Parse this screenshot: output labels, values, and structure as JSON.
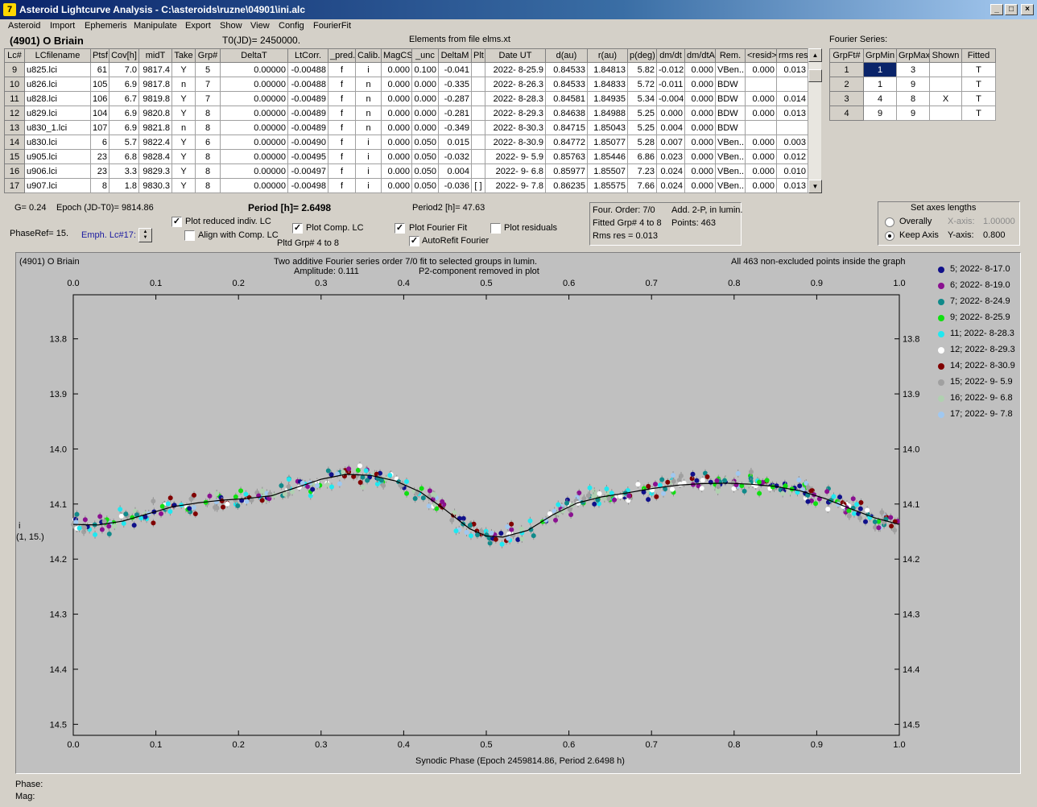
{
  "window": {
    "title": "Asteroid Lightcurve Analysis - C:\\asteroids\\ruzne\\04901\\ini.alc",
    "icon_letter": "7",
    "min_glyph": "_",
    "max_glyph": "□",
    "close_glyph": "×"
  },
  "menu": [
    "Asteroid",
    "Import",
    "Ephemeris",
    "Manipulate",
    "Export",
    "Show",
    "View",
    "Config",
    "FourierFit"
  ],
  "header": {
    "asteroid": "(4901) O Briain",
    "t0": "T0(JD)= 2450000.",
    "elements": "Elements from file elms.xt",
    "fourier_series_label": "Fourier Series:"
  },
  "lc_table": {
    "columns": [
      "Lc#",
      "LCfilename",
      "Ptsf",
      "Cov[h]",
      "midT",
      "Take",
      "Grp#",
      "DeltaT",
      "LtCorr.",
      "_pred.",
      "Calib.",
      "MagCS",
      "_unc",
      "DeltaM",
      "Plt",
      "Date UT",
      "d(au)",
      "r(au)",
      "p(deg)",
      "dm/dt",
      "dm/dtA",
      "Rem.",
      "<resid>",
      "rms res"
    ],
    "rows": [
      [
        "9",
        "u825.lci",
        "61",
        "7.0",
        "9817.4",
        "Y",
        "5",
        "0.00000",
        "-0.00488",
        "f",
        "i",
        "0.000",
        "0.100",
        "-0.041",
        "",
        "2022- 8-25.9",
        "0.84533",
        "1.84813",
        "5.82",
        "-0.012",
        "0.000",
        "VBen..",
        "0.000",
        "0.013"
      ],
      [
        "10",
        "u826.lci",
        "105",
        "6.9",
        "9817.8",
        "n",
        "7",
        "0.00000",
        "-0.00488",
        "f",
        "n",
        "0.000",
        "0.000",
        "-0.335",
        "",
        "2022- 8-26.3",
        "0.84533",
        "1.84833",
        "5.72",
        "-0.011",
        "0.000",
        "BDW",
        "",
        ""
      ],
      [
        "11",
        "u828.lci",
        "106",
        "6.7",
        "9819.8",
        "Y",
        "7",
        "0.00000",
        "-0.00489",
        "f",
        "n",
        "0.000",
        "0.000",
        "-0.287",
        "",
        "2022- 8-28.3",
        "0.84581",
        "1.84935",
        "5.34",
        "-0.004",
        "0.000",
        "BDW",
        "0.000",
        "0.014"
      ],
      [
        "12",
        "u829.lci",
        "104",
        "6.9",
        "9820.8",
        "Y",
        "8",
        "0.00000",
        "-0.00489",
        "f",
        "n",
        "0.000",
        "0.000",
        "-0.281",
        "",
        "2022- 8-29.3",
        "0.84638",
        "1.84988",
        "5.25",
        "0.000",
        "0.000",
        "BDW",
        "0.000",
        "0.013"
      ],
      [
        "13",
        "u830_1.lci",
        "107",
        "6.9",
        "9821.8",
        "n",
        "8",
        "0.00000",
        "-0.00489",
        "f",
        "n",
        "0.000",
        "0.000",
        "-0.349",
        "",
        "2022- 8-30.3",
        "0.84715",
        "1.85043",
        "5.25",
        "0.004",
        "0.000",
        "BDW",
        "",
        ""
      ],
      [
        "14",
        "u830.lci",
        "6",
        "5.7",
        "9822.4",
        "Y",
        "6",
        "0.00000",
        "-0.00490",
        "f",
        "i",
        "0.000",
        "0.050",
        "0.015",
        "",
        "2022- 8-30.9",
        "0.84772",
        "1.85077",
        "5.28",
        "0.007",
        "0.000",
        "VBen..",
        "0.000",
        "0.003"
      ],
      [
        "15",
        "u905.lci",
        "23",
        "6.8",
        "9828.4",
        "Y",
        "8",
        "0.00000",
        "-0.00495",
        "f",
        "i",
        "0.000",
        "0.050",
        "-0.032",
        "",
        "2022- 9- 5.9",
        "0.85763",
        "1.85446",
        "6.86",
        "0.023",
        "0.000",
        "VBen..",
        "0.000",
        "0.012"
      ],
      [
        "16",
        "u906.lci",
        "23",
        "3.3",
        "9829.3",
        "Y",
        "8",
        "0.00000",
        "-0.00497",
        "f",
        "i",
        "0.000",
        "0.050",
        "0.004",
        "",
        "2022- 9- 6.8",
        "0.85977",
        "1.85507",
        "7.23",
        "0.024",
        "0.000",
        "VBen..",
        "0.000",
        "0.010"
      ],
      [
        "17",
        "u907.lci",
        "8",
        "1.8",
        "9830.3",
        "Y",
        "8",
        "0.00000",
        "-0.00498",
        "f",
        "i",
        "0.000",
        "0.050",
        "-0.036",
        "[ ]",
        "2022- 9- 7.8",
        "0.86235",
        "1.85575",
        "7.66",
        "0.024",
        "0.000",
        "VBen..",
        "0.000",
        "0.013"
      ]
    ],
    "scroll_up": "▲",
    "scroll_down": "▼"
  },
  "fourier_table": {
    "columns": [
      "GrpFt#",
      "GrpMin",
      "GrpMax",
      "Shown",
      "Fitted"
    ],
    "rows": [
      [
        "1",
        "1",
        "3",
        "",
        "T"
      ],
      [
        "2",
        "1",
        "9",
        "",
        "T"
      ],
      [
        "3",
        "4",
        "8",
        "X",
        "T"
      ],
      [
        "4",
        "9",
        "9",
        "",
        "T"
      ]
    ]
  },
  "controls": {
    "g": "G= 0.24",
    "epoch": "Epoch (JD-T0)= 9814.86",
    "period_label": "Period [h]= 2.6498",
    "period2_label": "Period2 [h]= 47.63",
    "phaseref": "PhaseRef= 15.",
    "emph": "Emph. Lc#17:",
    "plot_reduced": "Plot reduced indiv. LC",
    "align_comp": "Align with Comp. LC",
    "plot_comp": "Plot Comp. LC",
    "pltd_grp": "Pltd Grp#  4   to    8",
    "plot_fourier": "Plot Fourier Fit",
    "autorefit": "AutoRefit Fourier",
    "plot_residuals": "Plot residuals",
    "check": "✓",
    "four_order": "Four. Order:  7/0",
    "add_2p": "Add. 2-P, in lumin.",
    "fitted_grp": "Fitted Grp# 4 to 8",
    "points": "Points: 463",
    "rms_res": "Rms res      = 0.013",
    "axes_title": "Set axes lengths",
    "overally": "Overally",
    "keep_axis": "Keep Axis",
    "xaxis_label": "X-axis:",
    "xaxis_value": "1.00000",
    "yaxis_label": "Y-axis:",
    "yaxis_value": "0.800"
  },
  "chart_data": {
    "type": "scatter",
    "corner_label": "(4901) O Briain",
    "title": "Two additive Fourier series order 7/0 fit to selected groups in lumin.",
    "subtitle_left": "Amplitude: 0.111",
    "subtitle_right": "P2-component removed in plot",
    "note": "All 463 non-excluded points inside the graph",
    "xlabel": "Synodic Phase (Epoch 2459814.86, Period 2.6498 h)",
    "ylabel": "i",
    "ylabel2": "(1, 15.)",
    "xlim": [
      0.0,
      1.0
    ],
    "ylim": [
      13.72,
      14.52
    ],
    "y_inverted": true,
    "x_ticks": [
      "0.0",
      "0.1",
      "0.2",
      "0.3",
      "0.4",
      "0.5",
      "0.6",
      "0.7",
      "0.8",
      "0.9",
      "1.0"
    ],
    "y_ticks": [
      "13.8",
      "13.9",
      "14.0",
      "14.1",
      "14.2",
      "14.3",
      "14.4",
      "14.5"
    ],
    "fit_curve": [
      [
        0.0,
        14.137
      ],
      [
        0.03,
        14.138
      ],
      [
        0.06,
        14.131
      ],
      [
        0.09,
        14.118
      ],
      [
        0.12,
        14.105
      ],
      [
        0.15,
        14.098
      ],
      [
        0.18,
        14.093
      ],
      [
        0.21,
        14.09
      ],
      [
        0.24,
        14.085
      ],
      [
        0.27,
        14.07
      ],
      [
        0.3,
        14.055
      ],
      [
        0.33,
        14.046
      ],
      [
        0.36,
        14.048
      ],
      [
        0.39,
        14.058
      ],
      [
        0.42,
        14.078
      ],
      [
        0.45,
        14.11
      ],
      [
        0.48,
        14.145
      ],
      [
        0.5,
        14.158
      ],
      [
        0.52,
        14.16
      ],
      [
        0.55,
        14.148
      ],
      [
        0.58,
        14.12
      ],
      [
        0.61,
        14.098
      ],
      [
        0.64,
        14.087
      ],
      [
        0.67,
        14.08
      ],
      [
        0.7,
        14.072
      ],
      [
        0.73,
        14.066
      ],
      [
        0.76,
        14.063
      ],
      [
        0.79,
        14.062
      ],
      [
        0.82,
        14.064
      ],
      [
        0.85,
        14.068
      ],
      [
        0.88,
        14.076
      ],
      [
        0.91,
        14.09
      ],
      [
        0.94,
        14.108
      ],
      [
        0.97,
        14.125
      ],
      [
        1.0,
        14.137
      ]
    ],
    "series": [
      {
        "name": "5; 2022- 8-17.0",
        "color": "#10108a"
      },
      {
        "name": "6; 2022- 8-19.0",
        "color": "#8a1090"
      },
      {
        "name": "7; 2022- 8-24.9",
        "color": "#108a8a"
      },
      {
        "name": "9; 2022- 8-25.9",
        "color": "#10e010"
      },
      {
        "name": "11; 2022- 8-28.3",
        "color": "#20e8f0"
      },
      {
        "name": "12; 2022- 8-29.3",
        "color": "#ffffff"
      },
      {
        "name": "14; 2022- 8-30.9",
        "color": "#800000"
      },
      {
        "name": "15; 2022- 9- 5.9",
        "color": "#a0a0a0"
      },
      {
        "name": "16; 2022- 9- 6.8",
        "color": "#b0d0b0"
      },
      {
        "name": "17; 2022- 9- 7.8",
        "color": "#a0c8f0"
      }
    ],
    "scatter_count": 463
  },
  "status": {
    "phase": "Phase:",
    "mag": "Mag:"
  }
}
